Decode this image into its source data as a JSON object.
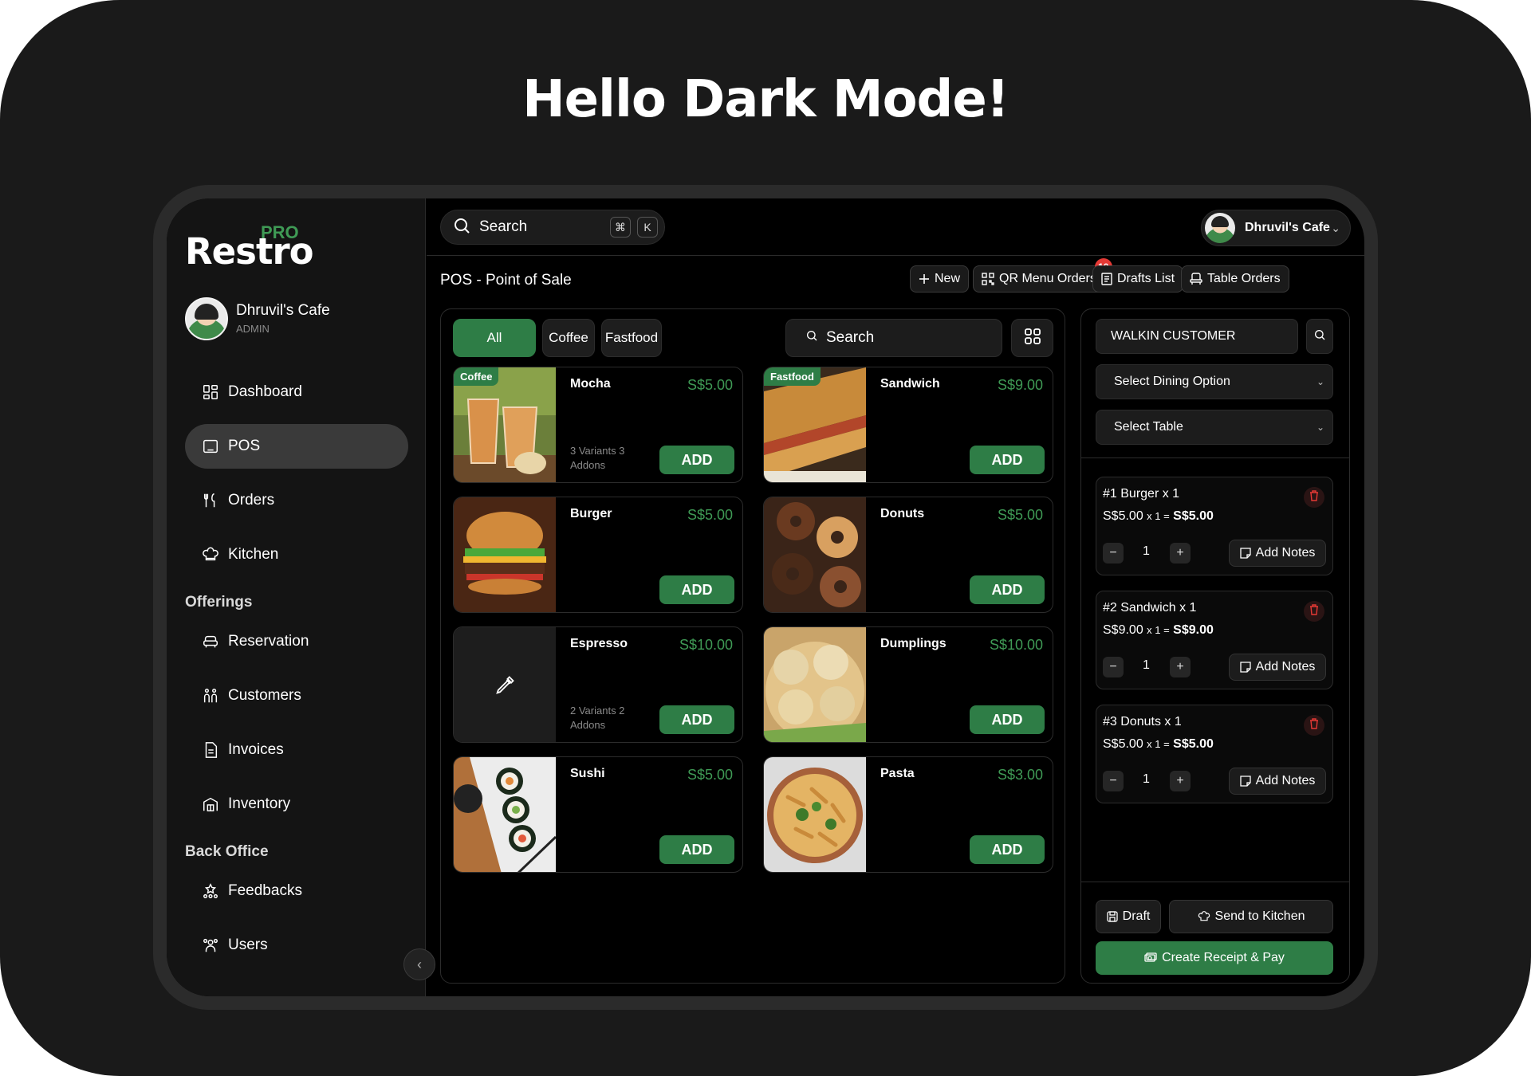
{
  "hero": {
    "title": "Hello Dark Mode!"
  },
  "brand": {
    "name": "Restro",
    "badge": "PRO"
  },
  "profile": {
    "name": "Dhruvil's Cafe",
    "role": "ADMIN"
  },
  "nav": {
    "dashboard": "Dashboard",
    "pos": "POS",
    "orders": "Orders",
    "kitchen": "Kitchen",
    "offerings_label": "Offerings",
    "reservation": "Reservation",
    "customers": "Customers",
    "invoices": "Invoices",
    "inventory": "Inventory",
    "backoffice_label": "Back Office",
    "feedbacks": "Feedbacks",
    "users": "Users"
  },
  "topbar": {
    "search_label": "Search",
    "kbd_cmd": "⌘",
    "kbd_k": "K",
    "cafe_name": "Dhruvil's Cafe"
  },
  "page": {
    "title": "POS - Point of Sale",
    "new_label": "New",
    "qr_label": "QR Menu Orders",
    "qr_count": "10",
    "drafts_label": "Drafts List",
    "table_orders_label": "Table Orders"
  },
  "filters": {
    "all": "All",
    "coffee": "Coffee",
    "fastfood": "Fastfood",
    "search_placeholder": "Search"
  },
  "products": [
    {
      "name": "Mocha",
      "price": "S$5.00",
      "tag": "Coffee",
      "sub": "3 Variants 3 Addons",
      "add": "ADD",
      "image": "iced-coffee-image"
    },
    {
      "name": "Sandwich",
      "price": "S$9.00",
      "tag": "Fastfood",
      "sub": "",
      "add": "ADD",
      "image": "sandwich-image"
    },
    {
      "name": "Burger",
      "price": "S$5.00",
      "tag": "",
      "sub": "",
      "add": "ADD",
      "image": "burger-image"
    },
    {
      "name": "Donuts",
      "price": "S$5.00",
      "tag": "",
      "sub": "",
      "add": "ADD",
      "image": "donuts-image"
    },
    {
      "name": "Espresso",
      "price": "S$10.00",
      "tag": "",
      "sub": "2 Variants 2 Addons",
      "add": "ADD",
      "image": "placeholder-icon"
    },
    {
      "name": "Dumplings",
      "price": "S$10.00",
      "tag": "",
      "sub": "",
      "add": "ADD",
      "image": "dumplings-image"
    },
    {
      "name": "Sushi",
      "price": "S$5.00",
      "tag": "",
      "sub": "",
      "add": "ADD",
      "image": "sushi-image"
    },
    {
      "name": "Pasta",
      "price": "S$3.00",
      "tag": "",
      "sub": "",
      "add": "ADD",
      "image": "pasta-image"
    }
  ],
  "cart": {
    "customer": "WALKIN CUSTOMER",
    "dining_option": "Select Dining Option",
    "table": "Select Table",
    "items": [
      {
        "title": "#1 Burger x 1",
        "unit": "S$5.00",
        "mult": "x 1 =",
        "total": "S$5.00",
        "qty": "1",
        "notes": "Add Notes"
      },
      {
        "title": "#2 Sandwich x 1",
        "unit": "S$9.00",
        "mult": "x 1 =",
        "total": "S$9.00",
        "qty": "1",
        "notes": "Add Notes"
      },
      {
        "title": "#3 Donuts x 1",
        "unit": "S$5.00",
        "mult": "x 1 =",
        "total": "S$5.00",
        "qty": "1",
        "notes": "Add Notes"
      }
    ],
    "draft_label": "Draft",
    "kitchen_label": "Send to Kitchen",
    "pay_label": "Create Receipt & Pay"
  },
  "colors": {
    "accent": "#2e7d46",
    "price": "#3f9a55",
    "bg": "#000000",
    "badge": "#e53935"
  }
}
